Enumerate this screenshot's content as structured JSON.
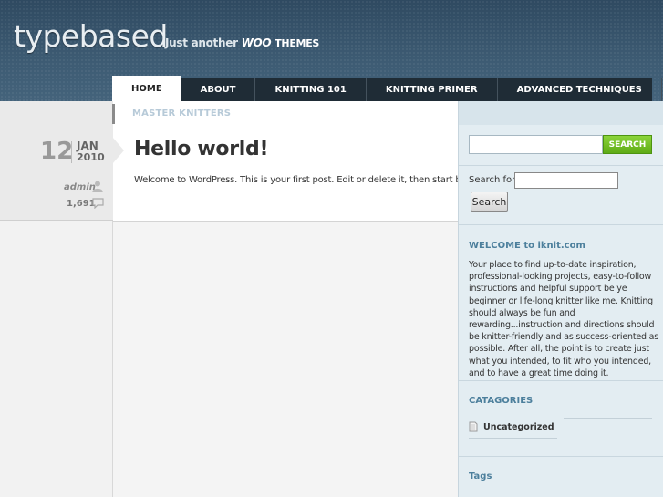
{
  "site": {
    "logo": "typebased",
    "tagline_prefix": "Just another",
    "tagline_brand": "WOO",
    "tagline_suffix": "THEMES"
  },
  "nav": {
    "items": [
      {
        "label": "HOME",
        "active": true
      },
      {
        "label": "ABOUT"
      },
      {
        "label": "KNITTING 101"
      },
      {
        "label": "KNITTING PRIMER"
      },
      {
        "label": "ADVANCED TECHNIQUES"
      }
    ],
    "sub": "MASTER KNITTERS"
  },
  "post": {
    "day": "12",
    "month": "JAN",
    "year": "2010",
    "author": "admin",
    "comments": "1,691",
    "title": "Hello world!",
    "body": "Welcome to WordPress. This is your first post. Edit or delete it, then start blogging!"
  },
  "sidebar": {
    "search_button": "SEARCH",
    "search_label": "Search for:",
    "search_submit": "Search",
    "welcome_title": "WELCOME to iknit.com",
    "welcome_text": "Your place to find up-to-date inspiration, professional-looking projects, easy-to-follow instructions and helpful support be ye beginner or life-long knitter like me. Knitting should always be fun and rewarding...instruction and directions should be knitter-friendly and as success-oriented as possible. After all, the point is to create just what you intended, to fit who you intended, and to have a great time doing it.",
    "categories_title": "CATAGORIES",
    "category": "Uncategorized",
    "tags_title": "Tags"
  },
  "colors": {
    "header_bg": "#3d5b73",
    "nav_bg": "#1f2c36",
    "accent_green": "#6fbf22",
    "sidebar_heading": "#4c7f9c",
    "sidebar_bg": "#e3edf2"
  },
  "icons": [
    "user-icon",
    "comment-icon",
    "category-icon"
  ]
}
